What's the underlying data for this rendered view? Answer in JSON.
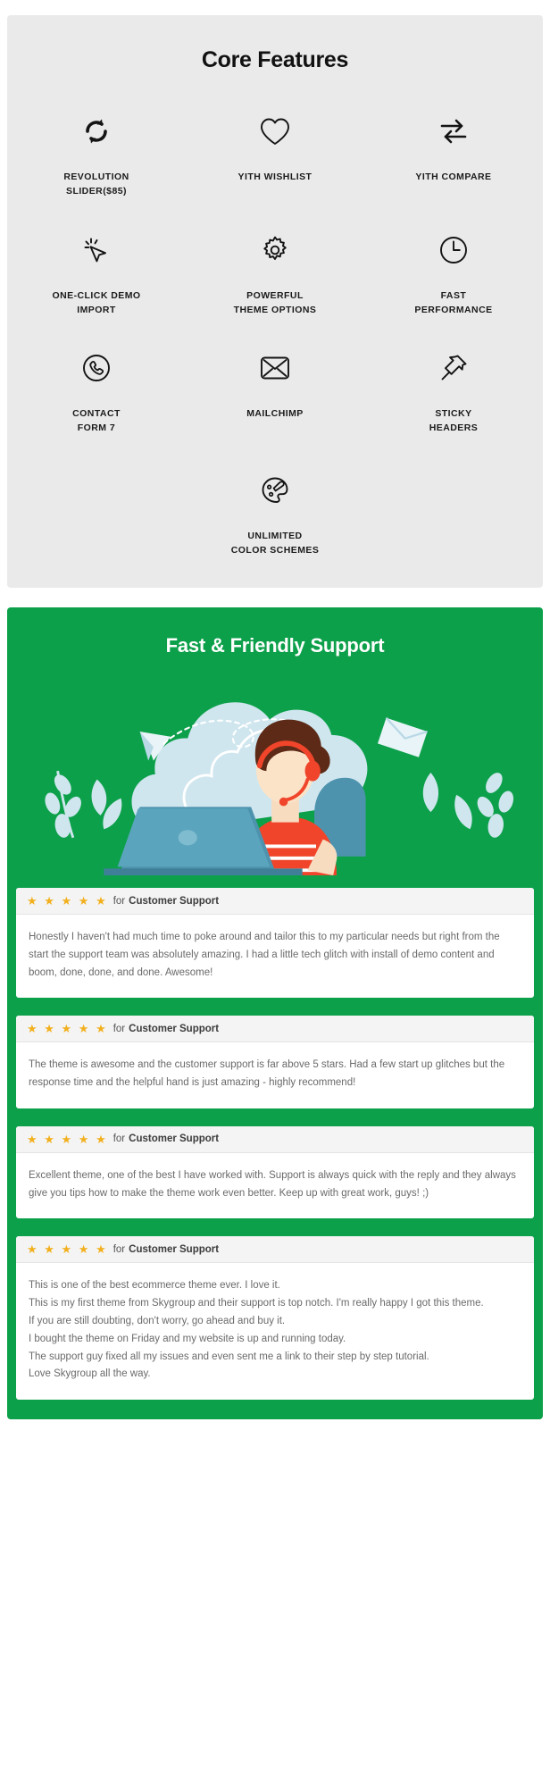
{
  "features_section": {
    "title": "Core Features",
    "items": [
      {
        "icon": "refresh-sync-icon",
        "label": "REVOLUTION\nSLIDER($85)"
      },
      {
        "icon": "heart-icon",
        "label": "YITH WISHLIST"
      },
      {
        "icon": "compare-arrows-icon",
        "label": "YITH COMPARE"
      },
      {
        "icon": "cursor-click-icon",
        "label": "ONE-CLICK DEMO\nIMPORT"
      },
      {
        "icon": "gear-icon",
        "label": "POWERFUL\nTHEME OPTIONS"
      },
      {
        "icon": "clock-icon",
        "label": "FAST\nPERFORMANCE"
      },
      {
        "icon": "phone-circle-icon",
        "label": "CONTACT\nFORM 7"
      },
      {
        "icon": "envelope-icon",
        "label": "MAILCHIMP"
      },
      {
        "icon": "pushpin-icon",
        "label": "STICKY\nHEADERS"
      }
    ],
    "last_item": {
      "icon": "palette-icon",
      "label": "UNLIMITED\nCOLOR SCHEMES"
    },
    "background_color": "#eaeaea",
    "text_color": "#111111"
  },
  "support_section": {
    "title": "Fast & Friendly Support",
    "background_color": "#0da04a",
    "illustration_name": "support-agent-headset-laptop-illustration",
    "reviews": [
      {
        "stars": "★ ★ ★ ★ ★",
        "rating": 5,
        "for_label": "for",
        "subject": "Customer Support",
        "body": "Honestly I haven't had much time to poke around and tailor this to my particular needs but right from the start the support team was absolutely amazing. I had a little tech glitch with install of demo content and boom, done, done, and done. Awesome!"
      },
      {
        "stars": "★ ★ ★ ★ ★",
        "rating": 5,
        "for_label": "for",
        "subject": "Customer Support",
        "body": "The theme is awesome and the customer support is far above 5 stars. Had a few start up glitches but the response time and the helpful hand is just amazing - highly recommend!"
      },
      {
        "stars": "★ ★ ★ ★ ★",
        "rating": 5,
        "for_label": "for",
        "subject": "Customer Support",
        "body": "Excellent theme, one of the best I have worked with. Support is always quick with the reply and they always give you tips how to make the theme work even better. Keep up with great work, guys! ;)"
      },
      {
        "stars": "★ ★ ★ ★ ★",
        "rating": 5,
        "for_label": "for",
        "subject": "Customer Support",
        "body": "This is one of the best ecommerce theme ever. I love it.\nThis is my first theme from Skygroup and their support is top notch. I'm really happy I got this theme.\nIf you are still doubting, don't worry, go ahead and buy it.\nI bought the theme on Friday and my website is up and running today.\nThe support guy fixed all my issues and even sent me a link to their step by step tutorial.\nLove Skygroup all the way."
      }
    ],
    "star_color": "#f2b01e"
  }
}
